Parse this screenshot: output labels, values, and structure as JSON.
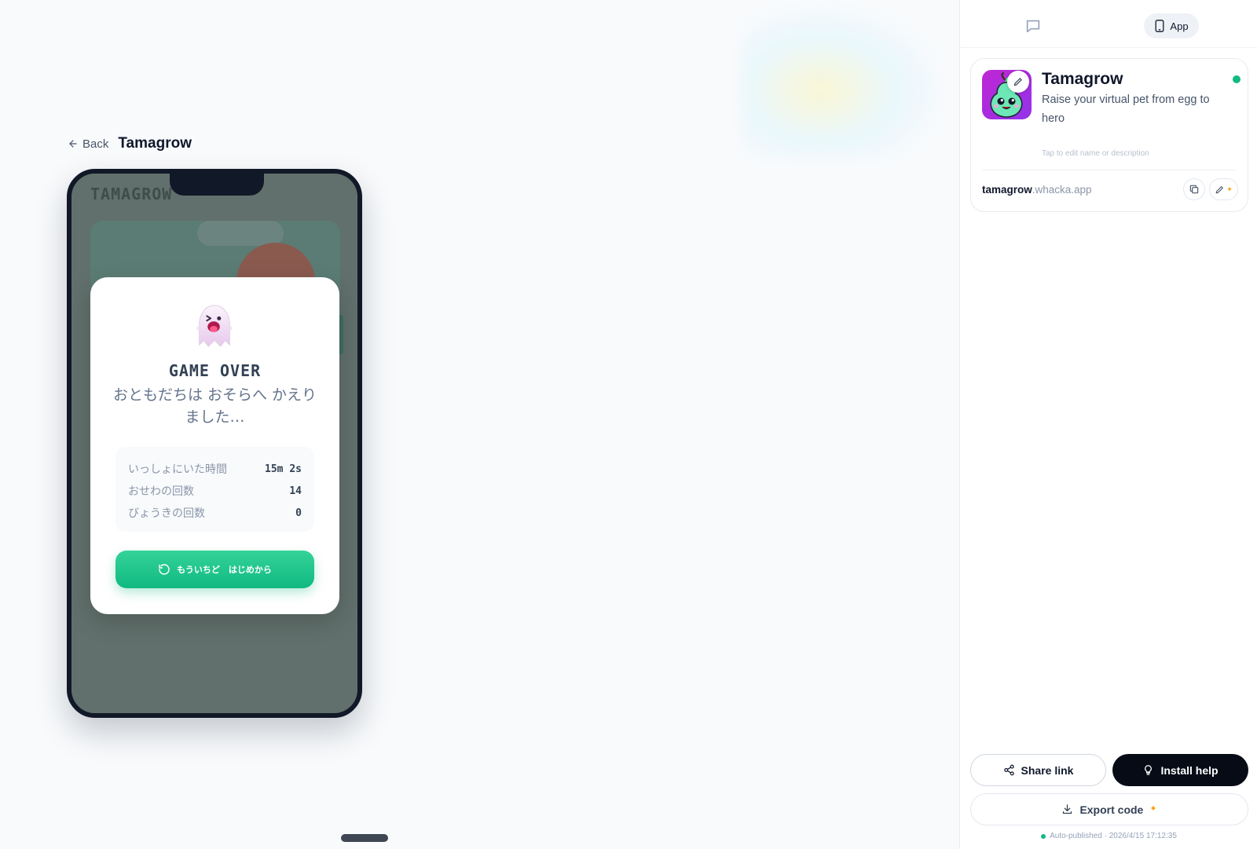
{
  "header": {
    "back_label": "Back",
    "app_title": "Tamagrow"
  },
  "game": {
    "background_title": "TAMAGROW",
    "dialog": {
      "title": "GAME OVER",
      "message": "おともだちは おそらへ かえりました…",
      "icon": "ghost-emoji",
      "stats": [
        {
          "label": "いっしょにいた時間",
          "value": "15m 2s"
        },
        {
          "label": "おせわの回数",
          "value": "14"
        },
        {
          "label": "びょうきの回数",
          "value": "0"
        }
      ],
      "restart_label": "もういちど　はじめから"
    }
  },
  "panel": {
    "tabs": {
      "chat_icon": "chat-bubble-icon",
      "app_label": "App"
    },
    "app_card": {
      "name": "Tamagrow",
      "description": "Raise your virtual pet from egg to hero",
      "edit_hint": "Tap to edit name or description",
      "url_subdomain": "tamagrow",
      "url_domain": ".whacka.app",
      "status_color": "#10b981"
    },
    "actions": {
      "share_label": "Share link",
      "install_label": "Install help",
      "export_label": "Export code"
    },
    "published_text": "Auto-published · 2026/4/15 17:12:35"
  },
  "colors": {
    "accent_green": "#10b981",
    "icon_bg": "#c026d3",
    "dark_button": "#060b16"
  }
}
